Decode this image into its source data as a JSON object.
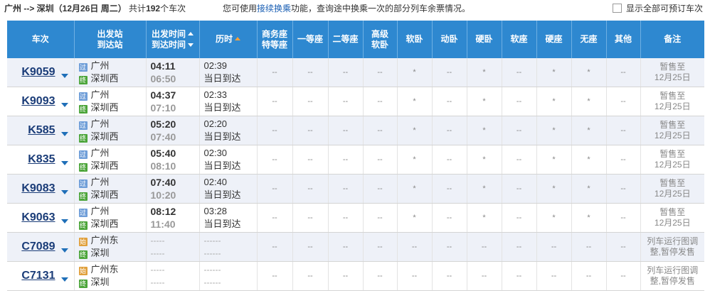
{
  "summary": {
    "route": "广州 --> 深圳",
    "date": "（12月26日 周二）",
    "count_prefix": "共计",
    "count": "192",
    "count_suffix": "个车次"
  },
  "notice": {
    "before": "您可使用",
    "link": "接续换乘",
    "after": "功能，查询途中换乘一次的部分列车余票情况。"
  },
  "show_all_label": "显示全部可预订车次",
  "headers": {
    "train": "车次",
    "station_from": "出发站",
    "station_to": "到达站",
    "time_from": "出发时间",
    "time_to": "到达时间",
    "duration": "历时",
    "biz_1": "商务座",
    "biz_2": "特等座",
    "first": "一等座",
    "second": "二等座",
    "adv_1": "高级",
    "adv_2": "软卧",
    "soft_sleeper": "软卧",
    "emu_sleeper": "动卧",
    "hard_sleeper": "硬卧",
    "soft_seat": "软座",
    "hard_seat": "硬座",
    "standing": "无座",
    "other": "其他",
    "remark": "备注"
  },
  "rows": [
    {
      "train": "K9059",
      "from_badge": "过",
      "from": "广州",
      "to_badge": "终",
      "to": "深圳西",
      "dep": "04:11",
      "arr": "06:50",
      "dur": "02:39",
      "day": "当日到达",
      "seats": [
        "--",
        "--",
        "--",
        "--",
        "*",
        "--",
        "*",
        "--",
        "*",
        "*",
        "--"
      ],
      "remark1": "暂售至",
      "remark2": "12月25日"
    },
    {
      "train": "K9093",
      "from_badge": "过",
      "from": "广州",
      "to_badge": "终",
      "to": "深圳西",
      "dep": "04:37",
      "arr": "07:10",
      "dur": "02:33",
      "day": "当日到达",
      "seats": [
        "--",
        "--",
        "--",
        "--",
        "*",
        "--",
        "*",
        "--",
        "*",
        "*",
        "--"
      ],
      "remark1": "暂售至",
      "remark2": "12月25日"
    },
    {
      "train": "K585",
      "from_badge": "过",
      "from": "广州",
      "to_badge": "终",
      "to": "深圳西",
      "dep": "05:20",
      "arr": "07:40",
      "dur": "02:20",
      "day": "当日到达",
      "seats": [
        "--",
        "--",
        "--",
        "--",
        "*",
        "--",
        "*",
        "--",
        "*",
        "*",
        "--"
      ],
      "remark1": "暂售至",
      "remark2": "12月25日"
    },
    {
      "train": "K835",
      "from_badge": "过",
      "from": "广州",
      "to_badge": "终",
      "to": "深圳西",
      "dep": "05:40",
      "arr": "08:10",
      "dur": "02:30",
      "day": "当日到达",
      "seats": [
        "--",
        "--",
        "--",
        "--",
        "*",
        "--",
        "*",
        "--",
        "*",
        "*",
        "--"
      ],
      "remark1": "暂售至",
      "remark2": "12月25日"
    },
    {
      "train": "K9083",
      "from_badge": "过",
      "from": "广州",
      "to_badge": "终",
      "to": "深圳西",
      "dep": "07:40",
      "arr": "10:20",
      "dur": "02:40",
      "day": "当日到达",
      "seats": [
        "--",
        "--",
        "--",
        "--",
        "*",
        "--",
        "*",
        "--",
        "*",
        "*",
        "--"
      ],
      "remark1": "暂售至",
      "remark2": "12月25日"
    },
    {
      "train": "K9063",
      "from_badge": "过",
      "from": "广州",
      "to_badge": "终",
      "to": "深圳西",
      "dep": "08:12",
      "arr": "11:40",
      "dur": "03:28",
      "day": "当日到达",
      "seats": [
        "--",
        "--",
        "--",
        "--",
        "*",
        "--",
        "*",
        "--",
        "*",
        "*",
        "--"
      ],
      "remark1": "暂售至",
      "remark2": "12月25日"
    },
    {
      "train": "C7089",
      "from_badge": "始",
      "from": "广州东",
      "to_badge": "终",
      "to": "深圳",
      "dep": "-----",
      "arr": "-----",
      "dur": "------",
      "day": "------",
      "seats": [
        "--",
        "--",
        "--",
        "--",
        "--",
        "--",
        "--",
        "--",
        "--",
        "--",
        "--"
      ],
      "remark1": "列车运行图调",
      "remark2": "整,暂停发售"
    },
    {
      "train": "C7131",
      "from_badge": "始",
      "from": "广州东",
      "to_badge": "终",
      "to": "深圳",
      "dep": "-----",
      "arr": "-----",
      "dur": "------",
      "day": "------",
      "seats": [
        "--",
        "--",
        "--",
        "--",
        "--",
        "--",
        "--",
        "--",
        "--",
        "--",
        "--"
      ],
      "remark1": "列车运行图调",
      "remark2": "整,暂停发售"
    }
  ]
}
